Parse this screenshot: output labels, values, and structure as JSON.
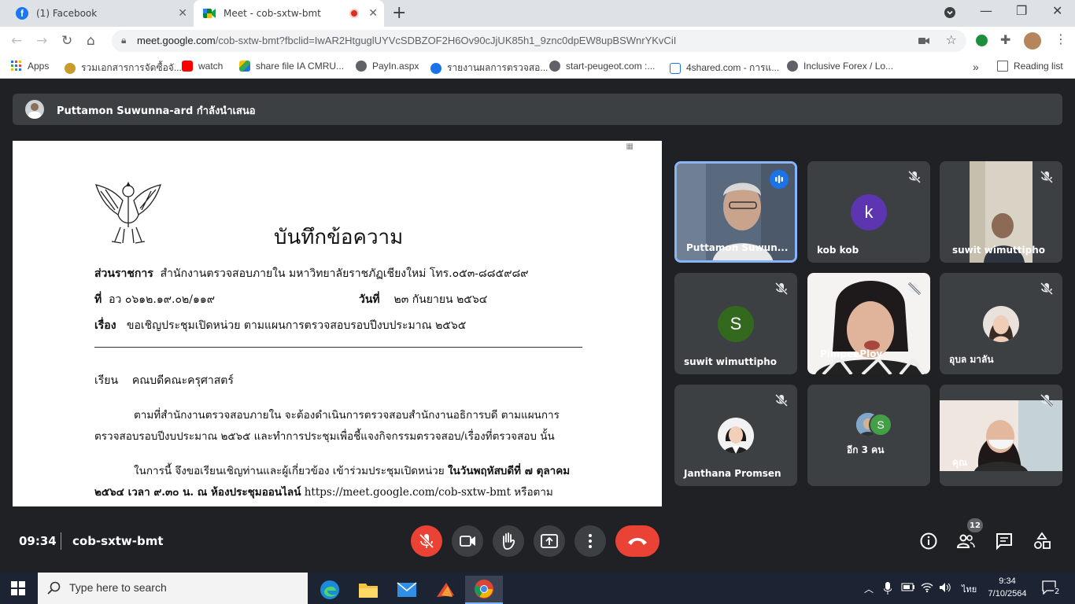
{
  "browser": {
    "tabs": [
      {
        "title": "(1) Facebook"
      },
      {
        "title": "Meet - cob-sxtw-bmt"
      }
    ],
    "url_host": "meet.google.com",
    "url_rest": "/cob-sxtw-bmt?fbclid=IwAR2HtguglUYVcSDBZOF2H6Ov90cJjUK85h1_9znc0dpEW8upBSWnrYKvCiI",
    "bookmarks": [
      {
        "label": "Apps"
      },
      {
        "label": "รวมเอกสารการจัดซื้อจั..."
      },
      {
        "label": "watch"
      },
      {
        "label": "share file IA CMRU..."
      },
      {
        "label": "PayIn.aspx"
      },
      {
        "label": "รายงานผลการตรวจสอ..."
      },
      {
        "label": "start-peugeot.com :..."
      },
      {
        "label": "4shared.com - การแ..."
      },
      {
        "label": "Inclusive Forex / Lo..."
      },
      {
        "label": "Reading list"
      }
    ],
    "more_bookmarks": "»"
  },
  "meet": {
    "presenter_text": "Puttamon Suwunna-ard กำลังนำเสนอ",
    "document": {
      "title": "บันทึกข้อความ",
      "line1_label": "ส่วนราชการ",
      "line1_text": "สำนักงานตรวจสอบภายใน  มหาวิทยาลัยราชภัฏเชียงใหม่   โทร.๐๕๓-๘๘๕๙๘๙",
      "line2_label": "ที่",
      "line2_text": "อว  ๐๖๑๒.๑๙.๐๒/๑๑๙",
      "line2_date_label": "วันที่",
      "line2_date": "๒๓  กันยายน  ๒๕๖๔",
      "line3_label": "เรื่อง",
      "line3_text": "ขอเชิญประชุมเปิดหน่วย ตามแผนการตรวจสอบรอบปีงบประมาณ ๒๕๖๕",
      "salutation_label": "เรียน",
      "salutation_text": "คณบดีคณะครุศาสตร์",
      "para1_a": "ตามที่สำนักงานตรวจสอบภายใน จะต้องดำเนินการตรวจสอบสำนักงานอธิการบดี ตามแผนการ",
      "para1_b": "ตรวจสอบรอบปีงบประมาณ ๒๕๖๕ และทำการประชุมเพื่อชี้แจงกิจกรรมตรวจสอบ/เรื่องที่ตรวจสอบ  นั้น",
      "para2_a": "ในการนี้ จึงขอเรียนเชิญท่านและผู้เกี่ยวข้อง เข้าร่วมประชุมเปิดหน่วย ",
      "para2_a_bold": "ในวันพฤหัสบดีที่ ๗  ตุลาคม",
      "para2_b_bold": "๒๕๖๔ เวลา ๙.๓๐ น. ณ ห้องประชุมออนไลน์",
      "para2_b": " https://meet.google.com/cob-sxtw-bmt หรือตาม"
    },
    "participants": [
      {
        "name": "Puttamon Suwun..."
      },
      {
        "name": "kob kob",
        "initial": "k"
      },
      {
        "name": "suwit wimuttipho"
      },
      {
        "name": "suwit wimuttipho",
        "initial": "S"
      },
      {
        "name": "PimpeePloy"
      },
      {
        "name": "อุบล มาลัน"
      },
      {
        "name": "Janthana Promsen"
      },
      {
        "name": "อีก 3 คน",
        "initial": "S"
      },
      {
        "name": "คุณ"
      }
    ],
    "time": "09:34",
    "meeting_code": "cob-sxtw-bmt",
    "people_count": "12"
  },
  "taskbar": {
    "search_placeholder": "Type here to search",
    "language": "ไทย",
    "clock_time": "9:34",
    "clock_date": "7/10/2564",
    "notification_count": "2"
  },
  "colors": {
    "meet_bg": "#202124",
    "tile_bg": "#3c4043",
    "red": "#ea4335",
    "active_border": "#8ab4f8"
  }
}
